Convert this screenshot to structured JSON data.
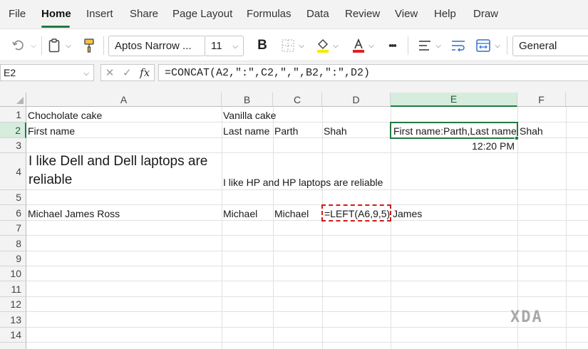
{
  "menu": {
    "items": [
      {
        "label": "File"
      },
      {
        "label": "Home"
      },
      {
        "label": "Insert"
      },
      {
        "label": "Share"
      },
      {
        "label": "Page Layout"
      },
      {
        "label": "Formulas"
      },
      {
        "label": "Data"
      },
      {
        "label": "Review"
      },
      {
        "label": "View"
      },
      {
        "label": "Help"
      },
      {
        "label": "Draw"
      }
    ],
    "active": "Home"
  },
  "ribbon": {
    "font_name": "Aptos Narrow ...",
    "font_size": "11",
    "bold_label": "B",
    "number_format": "General",
    "more_label": "•••",
    "icons": [
      "undo-icon",
      "clipboard-icon",
      "format-painter-icon",
      "bold-icon",
      "borders-icon",
      "fill-color-icon",
      "font-color-icon",
      "more-icon",
      "align-icon",
      "wrap-text-icon",
      "merge-icon"
    ],
    "accent_colors": {
      "fill": "#f5e900",
      "font": "#e02020"
    }
  },
  "formula_bar": {
    "name_box": "E2",
    "fx_label": "fx",
    "formula": "=CONCAT(A2,\":\",C2,\",\",B2,\":\",D2)"
  },
  "grid": {
    "columns": [
      "A",
      "B",
      "C",
      "D",
      "E",
      "F"
    ],
    "rows": [
      "1",
      "2",
      "3",
      "4",
      "5",
      "6",
      "7",
      "8",
      "9",
      "10",
      "11",
      "12",
      "13",
      "14"
    ],
    "selected_column": "E",
    "selected_row": "2",
    "cells": {
      "A1": "Chocholate cake",
      "B1": "Vanilla cake",
      "A2": "First name",
      "B2": "Last name",
      "C2": "Parth",
      "D2": "Shah",
      "E2": "First name:Parth,Last name",
      "F2": "Shah",
      "E3": "12:20 PM",
      "A4": "I like Dell and Dell laptops are reliable",
      "B4": "I like HP and HP laptops are reliable",
      "A6": "Michael James Ross",
      "B6": "Michael",
      "C6": "Michael",
      "D6": "=LEFT(A6,9,5)",
      "E6": "James"
    }
  },
  "watermark": "XDA",
  "colors": {
    "accent": "#1f7a43",
    "selection": "#d6ecdc",
    "dashed_border": "#d11a1a"
  }
}
